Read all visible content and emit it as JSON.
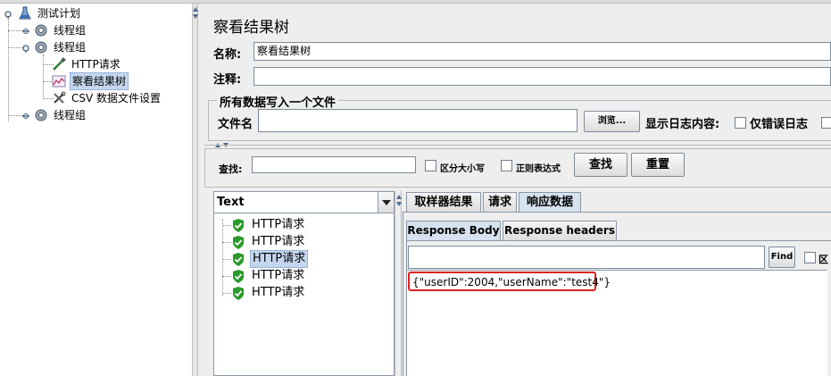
{
  "tree": {
    "items": [
      {
        "label": "测试计划",
        "icon": "test-plan-icon"
      },
      {
        "label": "线程组",
        "icon": "thread-group-icon"
      },
      {
        "label": "线程组",
        "icon": "thread-group-icon"
      },
      {
        "label": "HTTP请求",
        "icon": "http-sampler-icon"
      },
      {
        "label": "察看结果树",
        "icon": "view-results-tree-icon"
      },
      {
        "label": "CSV 数据文件设置",
        "icon": "csv-config-icon"
      },
      {
        "label": "线程组",
        "icon": "thread-group-icon"
      }
    ]
  },
  "panel": {
    "title": "察看结果树",
    "name_label": "名称:",
    "name_value": "察看结果树",
    "comment_label": "注释:",
    "comment_value": "",
    "file_group_title": "所有数据写入一个文件",
    "file_label": "文件名",
    "file_value": "",
    "browse_label": "浏览...",
    "log_content_label": "显示日志内容:",
    "errors_only_label": "仅错误日志"
  },
  "search": {
    "label": "查找:",
    "value": "",
    "case_sensitive_label": "区分大小写",
    "regex_label": "正则表达式",
    "find_button": "查找",
    "reset_button": "重置"
  },
  "results": {
    "renderer": "Text",
    "samples": [
      {
        "label": "HTTP请求",
        "status": "success"
      },
      {
        "label": "HTTP请求",
        "status": "success"
      },
      {
        "label": "HTTP请求",
        "status": "success"
      },
      {
        "label": "HTTP请求",
        "status": "success"
      },
      {
        "label": "HTTP请求",
        "status": "success"
      }
    ],
    "tabs": [
      "取样器结果",
      "请求",
      "响应数据"
    ],
    "active_tab": "响应数据",
    "subtabs": [
      "Response Body",
      "Response headers"
    ],
    "active_subtab": "Response Body",
    "find_button": "Find",
    "find_value": "",
    "find_option_label": "区",
    "response_body": "{\"userID\":2004,\"userName\":\"test4\"}"
  },
  "colors": {
    "selection": "#c5d7ef",
    "highlight_border": "#e02020",
    "success_icon": "#2a9a2a"
  }
}
